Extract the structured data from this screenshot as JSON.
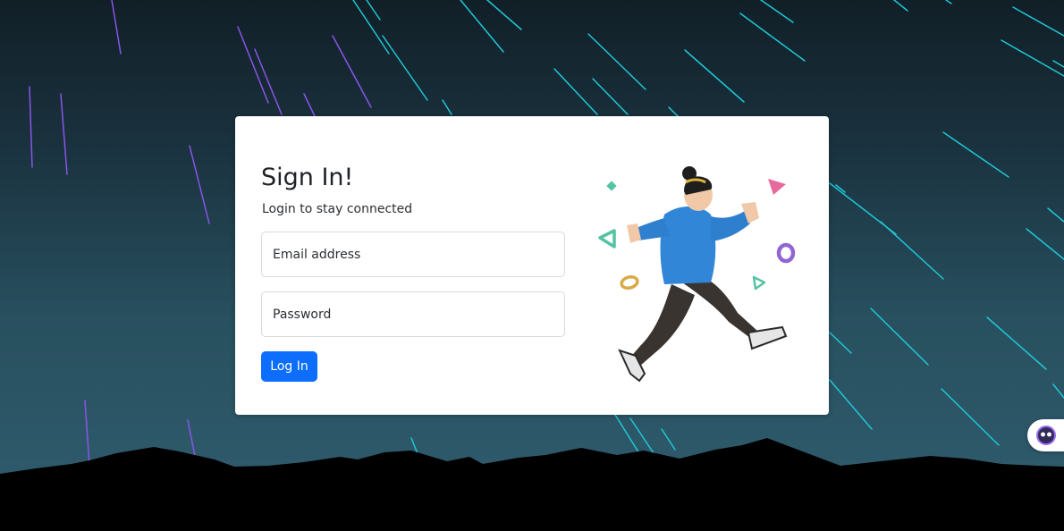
{
  "login": {
    "title": "Sign In!",
    "subtitle": "Login to stay connected",
    "email_placeholder": "Email address",
    "password_placeholder": "Password",
    "submit_label": "Log In"
  },
  "illustration": {
    "icon": "running-person-illustration"
  },
  "assistant": {
    "icon": "chat-assistant-icon"
  },
  "colors": {
    "primary": "#0d6efd",
    "background_top": "#111f27",
    "background_bottom": "#305d6f",
    "streak_cyan": "#1fc7d6",
    "streak_purple": "#8a55e8"
  }
}
